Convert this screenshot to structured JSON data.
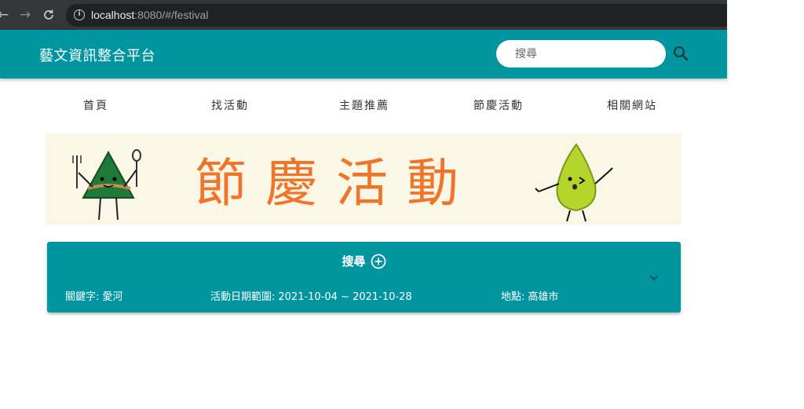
{
  "browser": {
    "url_host": "localhost",
    "url_rest": ":8080/#/festival"
  },
  "header": {
    "brand": "藝文資訊整合平台",
    "search_placeholder": "搜尋",
    "color": "#00959f"
  },
  "nav": {
    "items": [
      {
        "label": "首頁"
      },
      {
        "label": "找活動"
      },
      {
        "label": "主題推薦"
      },
      {
        "label": "節慶活動"
      },
      {
        "label": "相關網站"
      }
    ]
  },
  "banner": {
    "title": "節慶活動",
    "title_color": "#f0752b",
    "background": "#fbf7e7"
  },
  "search_panel": {
    "title": "搜尋",
    "keyword_label": "關鍵字:",
    "keyword_value": "愛河",
    "date_label": "活動日期範圍:",
    "date_value": "2021-10-04 ~ 2021-10-28",
    "location_label": "地點:",
    "location_value": "高雄市"
  }
}
